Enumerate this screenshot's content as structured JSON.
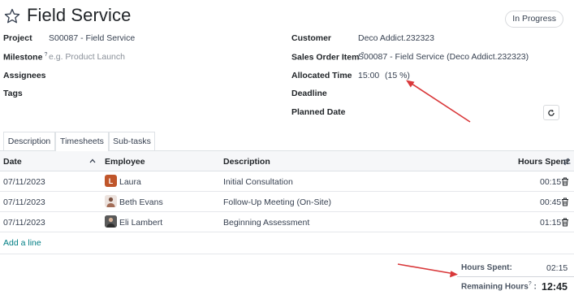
{
  "title": "Field Service",
  "status": "In Progress",
  "fields_left": {
    "project_label": "Project",
    "project_value": "S00087 - Field Service",
    "milestone_label": "Milestone",
    "milestone_help": "?",
    "milestone_placeholder": "e.g. Product Launch",
    "assignees_label": "Assignees",
    "tags_label": "Tags"
  },
  "fields_right": {
    "customer_label": "Customer",
    "customer_value": "Deco Addict.232323",
    "sales_order_label": "Sales Order Item",
    "sales_order_help": "?",
    "sales_order_value": "S00087 - Field Service (Deco Addict.232323)",
    "allocated_label": "Allocated Time",
    "allocated_value": "15:00",
    "allocated_percent": "(15 %)",
    "deadline_label": "Deadline",
    "planned_label": "Planned Date"
  },
  "tabs": [
    {
      "label": "Description",
      "active": false
    },
    {
      "label": "Timesheets",
      "active": true
    },
    {
      "label": "Sub-tasks",
      "active": false
    }
  ],
  "table": {
    "columns": {
      "date": "Date",
      "employee": "Employee",
      "description": "Description",
      "hours": "Hours Spent"
    },
    "rows": [
      {
        "date": "07/11/2023",
        "employee": "Laura",
        "avatar_letter": "L",
        "avatar_color": "#c0562b",
        "description": "Initial Consultation",
        "hours": "00:15"
      },
      {
        "date": "07/11/2023",
        "employee": "Beth Evans",
        "avatar_letter": "",
        "avatar_color": "#e9dcd6",
        "description": "Follow-Up Meeting (On-Site)",
        "hours": "00:45"
      },
      {
        "date": "07/11/2023",
        "employee": "Eli Lambert",
        "avatar_letter": "",
        "avatar_color": "#4b4b4b",
        "description": "Beginning Assessment",
        "hours": "01:15"
      }
    ],
    "add_line": "Add a line"
  },
  "summary": {
    "hours_spent_label": "Hours Spent:",
    "hours_spent_value": "02:15",
    "remaining_label": "Remaining Hours",
    "remaining_help": "?",
    "remaining_colon": ":",
    "remaining_value": "12:45"
  },
  "colors": {
    "annotation": "#d9383a",
    "link": "#017e84"
  }
}
